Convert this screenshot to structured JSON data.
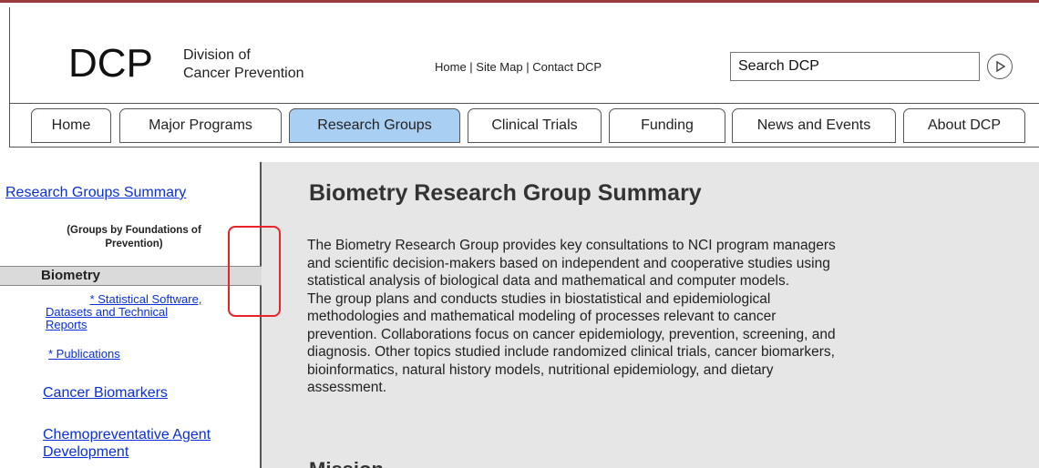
{
  "header": {
    "logo_abbr": "DCP",
    "logo_line1": "Division of",
    "logo_line2": "Cancer Prevention",
    "top_links": [
      "Home",
      "Site Map",
      "Contact DCP"
    ],
    "separator": " | ",
    "search_value": "Search DCP",
    "search_icon": "play-circle-icon"
  },
  "tabs": [
    {
      "label": "Home",
      "active": false
    },
    {
      "label": "Major Programs",
      "active": false
    },
    {
      "label": "Research Groups",
      "active": true
    },
    {
      "label": "Clinical Trials",
      "active": false
    },
    {
      "label": "Funding",
      "active": false
    },
    {
      "label": "News and Events",
      "active": false
    },
    {
      "label": "About DCP",
      "active": false
    }
  ],
  "sidebar": {
    "summary_link": "Research Groups Summary",
    "groups_note_line1": "(Groups by Foundations of",
    "groups_note_line2": "Prevention)",
    "current_group": "Biometry",
    "sub_links": [
      {
        "line1": "* Statistical Software,",
        "line2": "Datasets and Technical",
        "line3": "Reports"
      },
      {
        "line1": "* Publications"
      }
    ],
    "cancer_biomarkers": "Cancer Biomarkers",
    "chemo_line1": "Chemopreventative Agent",
    "chemo_line2": "Development"
  },
  "main": {
    "title": "Biometry Research Group Summary",
    "body_lines": [
      "The Biometry Research Group provides key consultations to NCI program managers",
      "and scientific decision-makers based on independent and cooperative studies using",
      "statistical analysis of biological data and mathematical and computer models.",
      "The group plans and conducts studies in biostatistical and epidemiological",
      "methodologies and mathematical modeling of processes relevant to cancer",
      "prevention. Collaborations focus on cancer epidemiology, prevention, screening, and",
      "diagnosis. Other topics studied include randomized clinical trials, cancer biomarkers,",
      "bioinformatics, natural history models, nutritional epidemiology, and dietary",
      "assessment."
    ],
    "next_heading": "Mission"
  },
  "colors": {
    "active_tab": "#a9cff3",
    "link": "#0a2fd6",
    "highlight": "#e8232a",
    "content_bg": "#e6e6e6"
  }
}
